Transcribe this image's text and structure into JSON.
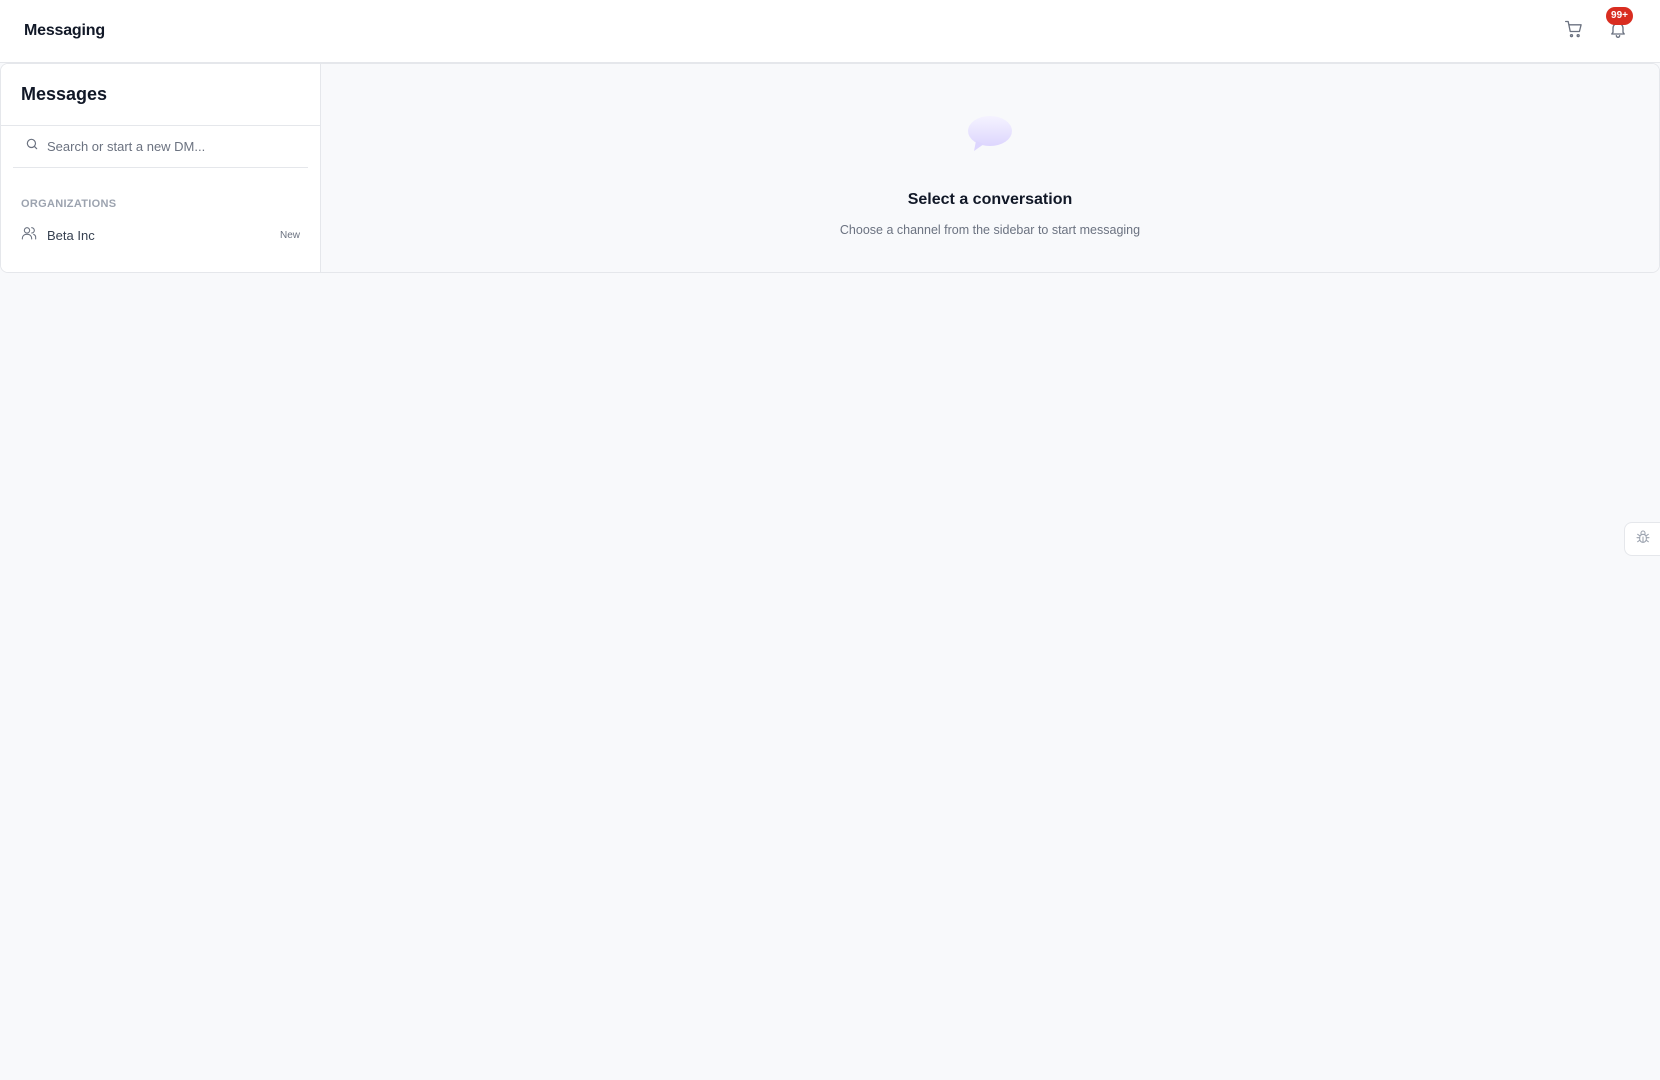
{
  "header": {
    "title": "Messaging",
    "cart_icon": "cart-icon",
    "notifications_icon": "bell-icon",
    "notification_badge": "99+",
    "badge_color": "#d92d20"
  },
  "sidebar": {
    "title": "Messages",
    "search": {
      "placeholder": "Search or start a new DM...",
      "value": "",
      "icon": "search-icon"
    },
    "section_label": "ORGANIZATIONS",
    "organizations": [
      {
        "name": "Beta Inc",
        "badge": "New",
        "icon": "users-icon"
      }
    ]
  },
  "main": {
    "icon": "chat-bubble-icon",
    "title": "Select a conversation",
    "subtitle": "Choose a channel from the sidebar to start messaging"
  },
  "debug": {
    "icon": "bug-icon"
  }
}
